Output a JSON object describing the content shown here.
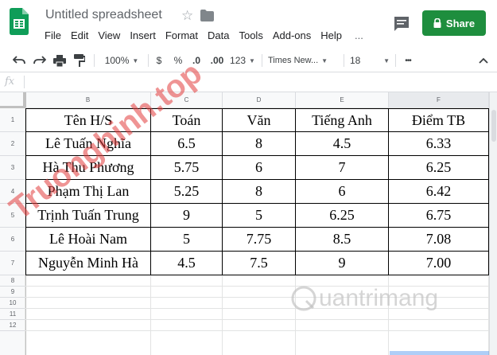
{
  "header": {
    "title": "Untitled spreadsheet",
    "share_label": "Share"
  },
  "menu": [
    "File",
    "Edit",
    "View",
    "Insert",
    "Format",
    "Data",
    "Tools",
    "Add-ons",
    "Help",
    "..."
  ],
  "toolbar": {
    "zoom": "100%",
    "currency": "$",
    "percent": "%",
    "decrease_decimal": ".0",
    "increase_decimal": ".00",
    "more_formats": "123",
    "font": "Times New...",
    "font_size": "18",
    "more": "•••"
  },
  "formula_bar": {
    "fx": "fx",
    "value": ""
  },
  "columns": [
    "B",
    "C",
    "D",
    "E",
    "F"
  ],
  "rows": [
    "1",
    "2",
    "3",
    "4",
    "5",
    "6",
    "7",
    "8",
    "9",
    "10",
    "11",
    "12"
  ],
  "table": [
    [
      "Tên H/S",
      "Toán",
      "Văn",
      "Tiếng Anh",
      "Điểm TB"
    ],
    [
      "Lê Tuấn Nghĩa",
      "6.5",
      "8",
      "4.5",
      "6.33"
    ],
    [
      "Hà Thu Phương",
      "5.75",
      "6",
      "7",
      "6.25"
    ],
    [
      "Phạm Thị Lan",
      "5.25",
      "8",
      "6",
      "6.42"
    ],
    [
      "Trịnh Tuấn Trung",
      "9",
      "5",
      "6.25",
      "6.75"
    ],
    [
      "Lê Hoài Nam",
      "5",
      "7.75",
      "8.5",
      "7.08"
    ],
    [
      "Nguyễn Minh Hà",
      "4.5",
      "7.5",
      "9",
      "7.00"
    ]
  ],
  "watermarks": {
    "red": "Truonghinh.top",
    "logo": "uantrimang"
  },
  "colors": {
    "share": "#1e8e3e",
    "sheets_green": "#0f9d58",
    "selected_header": "#e8eaed"
  }
}
